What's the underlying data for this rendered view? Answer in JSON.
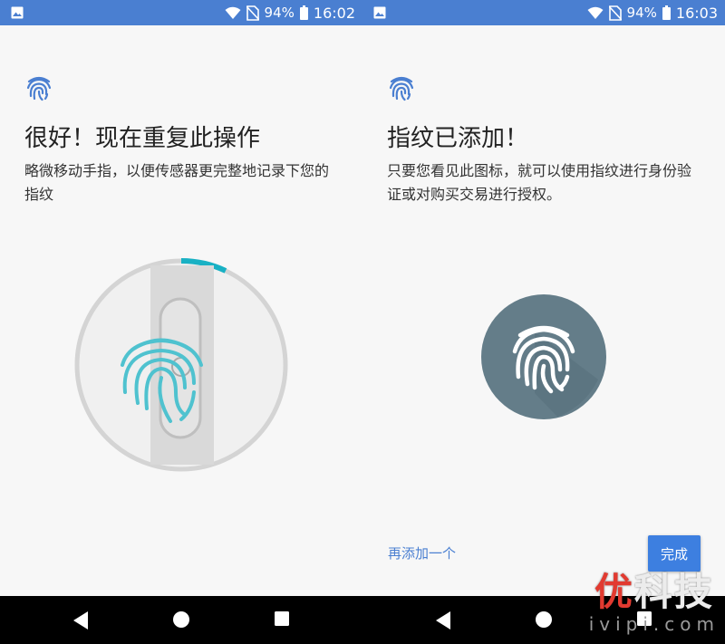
{
  "left_screen": {
    "status": {
      "battery": "94%",
      "time": "16:02"
    },
    "title": "很好！现在重复此操作",
    "subtitle": "略微移动手指，以便传感器更完整地记录下您的指纹",
    "progress": 0.07
  },
  "right_screen": {
    "status": {
      "battery": "94%",
      "time": "16:03"
    },
    "title": "指纹已添加！",
    "subtitle": "只要您看见此图标，就可以使用指纹进行身份验证或对购买交易进行授权。",
    "add_another_label": "再添加一个",
    "done_label": "完成"
  },
  "watermark": {
    "red_char": "优",
    "rest": "科技",
    "sub": "ivipi.com"
  },
  "colors": {
    "status_bar": "#4a7fd1",
    "accent": "#4a7fd1",
    "progress": "#19b1c4",
    "fingerprint_circle": "#647d89",
    "background": "#f7f7f7",
    "nav_bar": "#000000"
  },
  "icons": [
    "image-icon",
    "wifi-icon",
    "no-sim-icon",
    "battery-icon",
    "fingerprint-icon",
    "back-icon",
    "home-icon",
    "recents-icon"
  ]
}
